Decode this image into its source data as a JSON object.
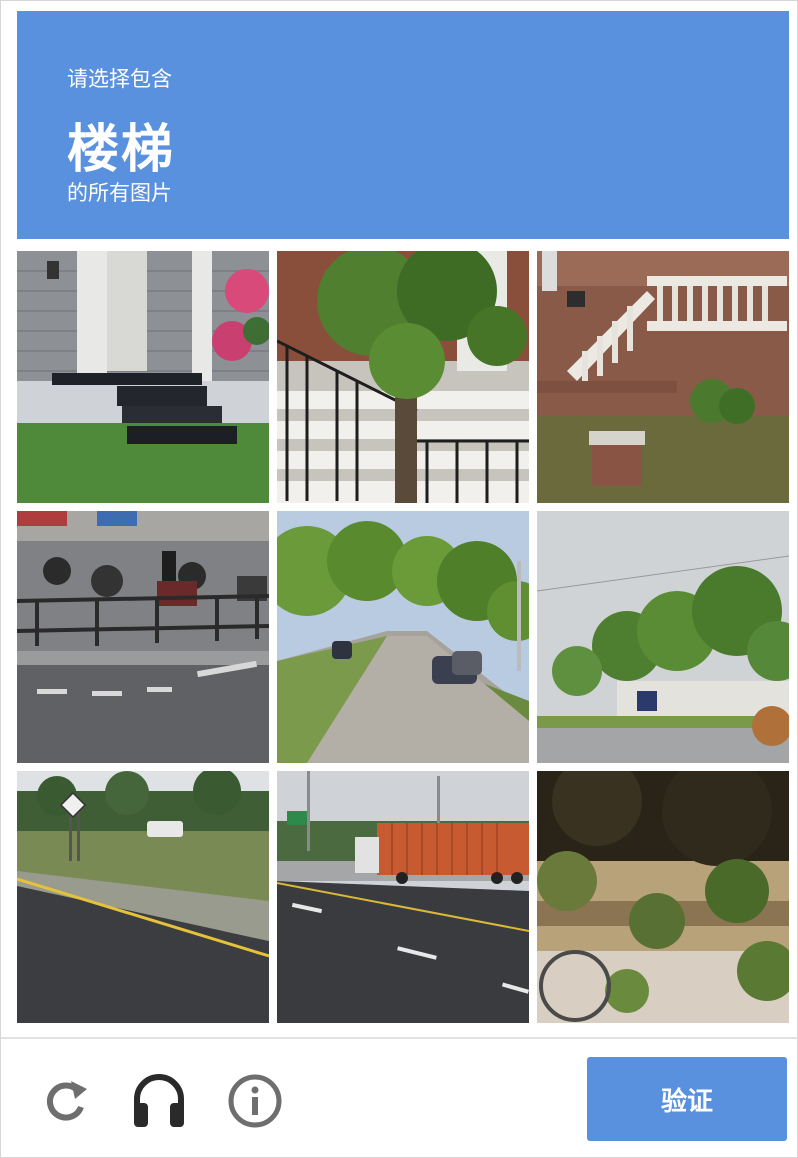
{
  "header": {
    "line1": "请选择包含",
    "target": "楼梯",
    "line3": "的所有图片",
    "background_color": "#5a91de"
  },
  "tiles": [
    {
      "description_icon": "porch-stairs-image"
    },
    {
      "description_icon": "stoop-tree-image"
    },
    {
      "description_icon": "brick-stairs-image"
    },
    {
      "description_icon": "motorcycles-street-image"
    },
    {
      "description_icon": "residential-street-image"
    },
    {
      "description_icon": "trees-building-image"
    },
    {
      "description_icon": "highway-sign-image"
    },
    {
      "description_icon": "highway-truck-image"
    },
    {
      "description_icon": "blurred-foliage-image"
    }
  ],
  "footer": {
    "reload_icon": "reload-icon",
    "audio_icon": "headphones-icon",
    "info_icon": "info-icon",
    "verify_label": "验证"
  }
}
